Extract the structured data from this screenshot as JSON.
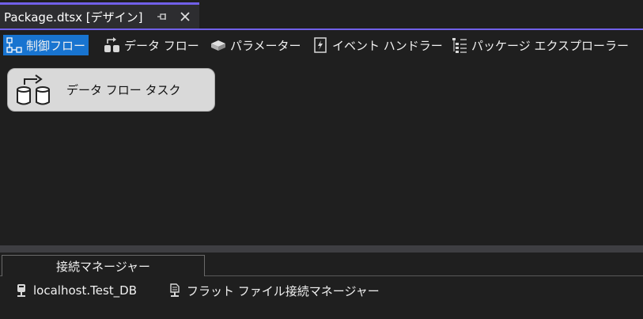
{
  "document_tab": {
    "title": "Package.dtsx [デザイン]",
    "pin_icon": "pin-icon",
    "close_icon": "close-icon"
  },
  "designer_tabs": [
    {
      "label": "制御フロー",
      "icon": "control-flow-icon",
      "active": true
    },
    {
      "label": "データ フロー",
      "icon": "data-flow-icon",
      "active": false
    },
    {
      "label": "パラメーター",
      "icon": "parameters-icon",
      "active": false
    },
    {
      "label": "イベント ハンドラー",
      "icon": "event-handler-icon",
      "active": false
    },
    {
      "label": "パッケージ エクスプローラー",
      "icon": "package-explorer-icon",
      "active": false
    }
  ],
  "canvas": {
    "task": {
      "label": "データ フロー タスク",
      "icon": "data-flow-task-icon"
    }
  },
  "connection_manager": {
    "tab_label": "接続マネージャー",
    "items": [
      {
        "label": "localhost.Test_DB",
        "icon": "db-connection-icon"
      },
      {
        "label": "フラット ファイル接続マネージャー",
        "icon": "flat-file-connection-icon"
      }
    ]
  },
  "colors": {
    "accent": "#7160e8",
    "active_tab": "#1874d0",
    "background": "#1f1f1f",
    "task_box": "#d9d9d9"
  }
}
